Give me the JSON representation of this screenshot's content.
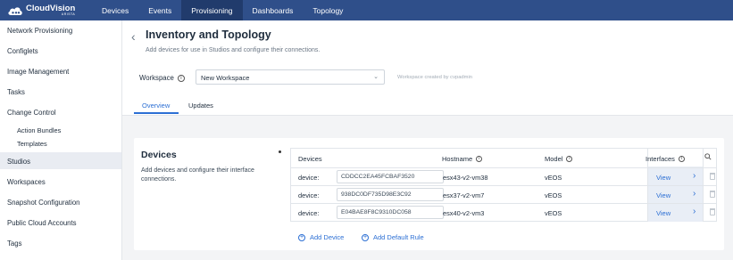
{
  "brand": {
    "title": "CloudVision",
    "subtitle": "ARISTA"
  },
  "topnav": [
    "Devices",
    "Events",
    "Provisioning",
    "Dashboards",
    "Topology"
  ],
  "topnav_active": "Provisioning",
  "sidebar": {
    "items": [
      "Network Provisioning",
      "Configlets",
      "Image Management",
      "Tasks",
      "Change Control",
      "Action Bundles",
      "Templates",
      "Studios",
      "Workspaces",
      "Snapshot Configuration",
      "Public Cloud Accounts",
      "Tags"
    ],
    "active": "Studios"
  },
  "page": {
    "title": "Inventory and Topology",
    "subtitle": "Add devices for use in Studios and configure their connections."
  },
  "workspace": {
    "label": "Workspace",
    "value": "New Workspace",
    "note": "Workspace created by cvpadmin"
  },
  "tabs": [
    "Overview",
    "Updates"
  ],
  "tabs_active": "Overview",
  "devices_card": {
    "title": "Devices",
    "description": "Add devices and configure their interface connections.",
    "columns": [
      "Devices",
      "Hostname",
      "Model",
      "Interfaces"
    ],
    "rows": [
      {
        "label": "device:",
        "device_id": "CDDCC2EA45FCBAF3520",
        "hostname": "esx43-v2-vm38",
        "model": "vEOS",
        "interfaces": "View"
      },
      {
        "label": "device:",
        "device_id": "938DC0DF735D98E3C92",
        "hostname": "esx37-v2-vm7",
        "model": "vEOS",
        "interfaces": "View"
      },
      {
        "label": "device:",
        "device_id": "E04BAE8F8C9310DC058",
        "hostname": "esx40-v2-vm3",
        "model": "vEOS",
        "interfaces": "View"
      }
    ],
    "add_device": "Add Device",
    "add_default_rule": "Add Default Rule"
  },
  "colors": {
    "topnav": "#2f4f8a",
    "topnav_active": "#213b6c",
    "accent": "#2c6fd4",
    "background": "#f3f4f6"
  }
}
